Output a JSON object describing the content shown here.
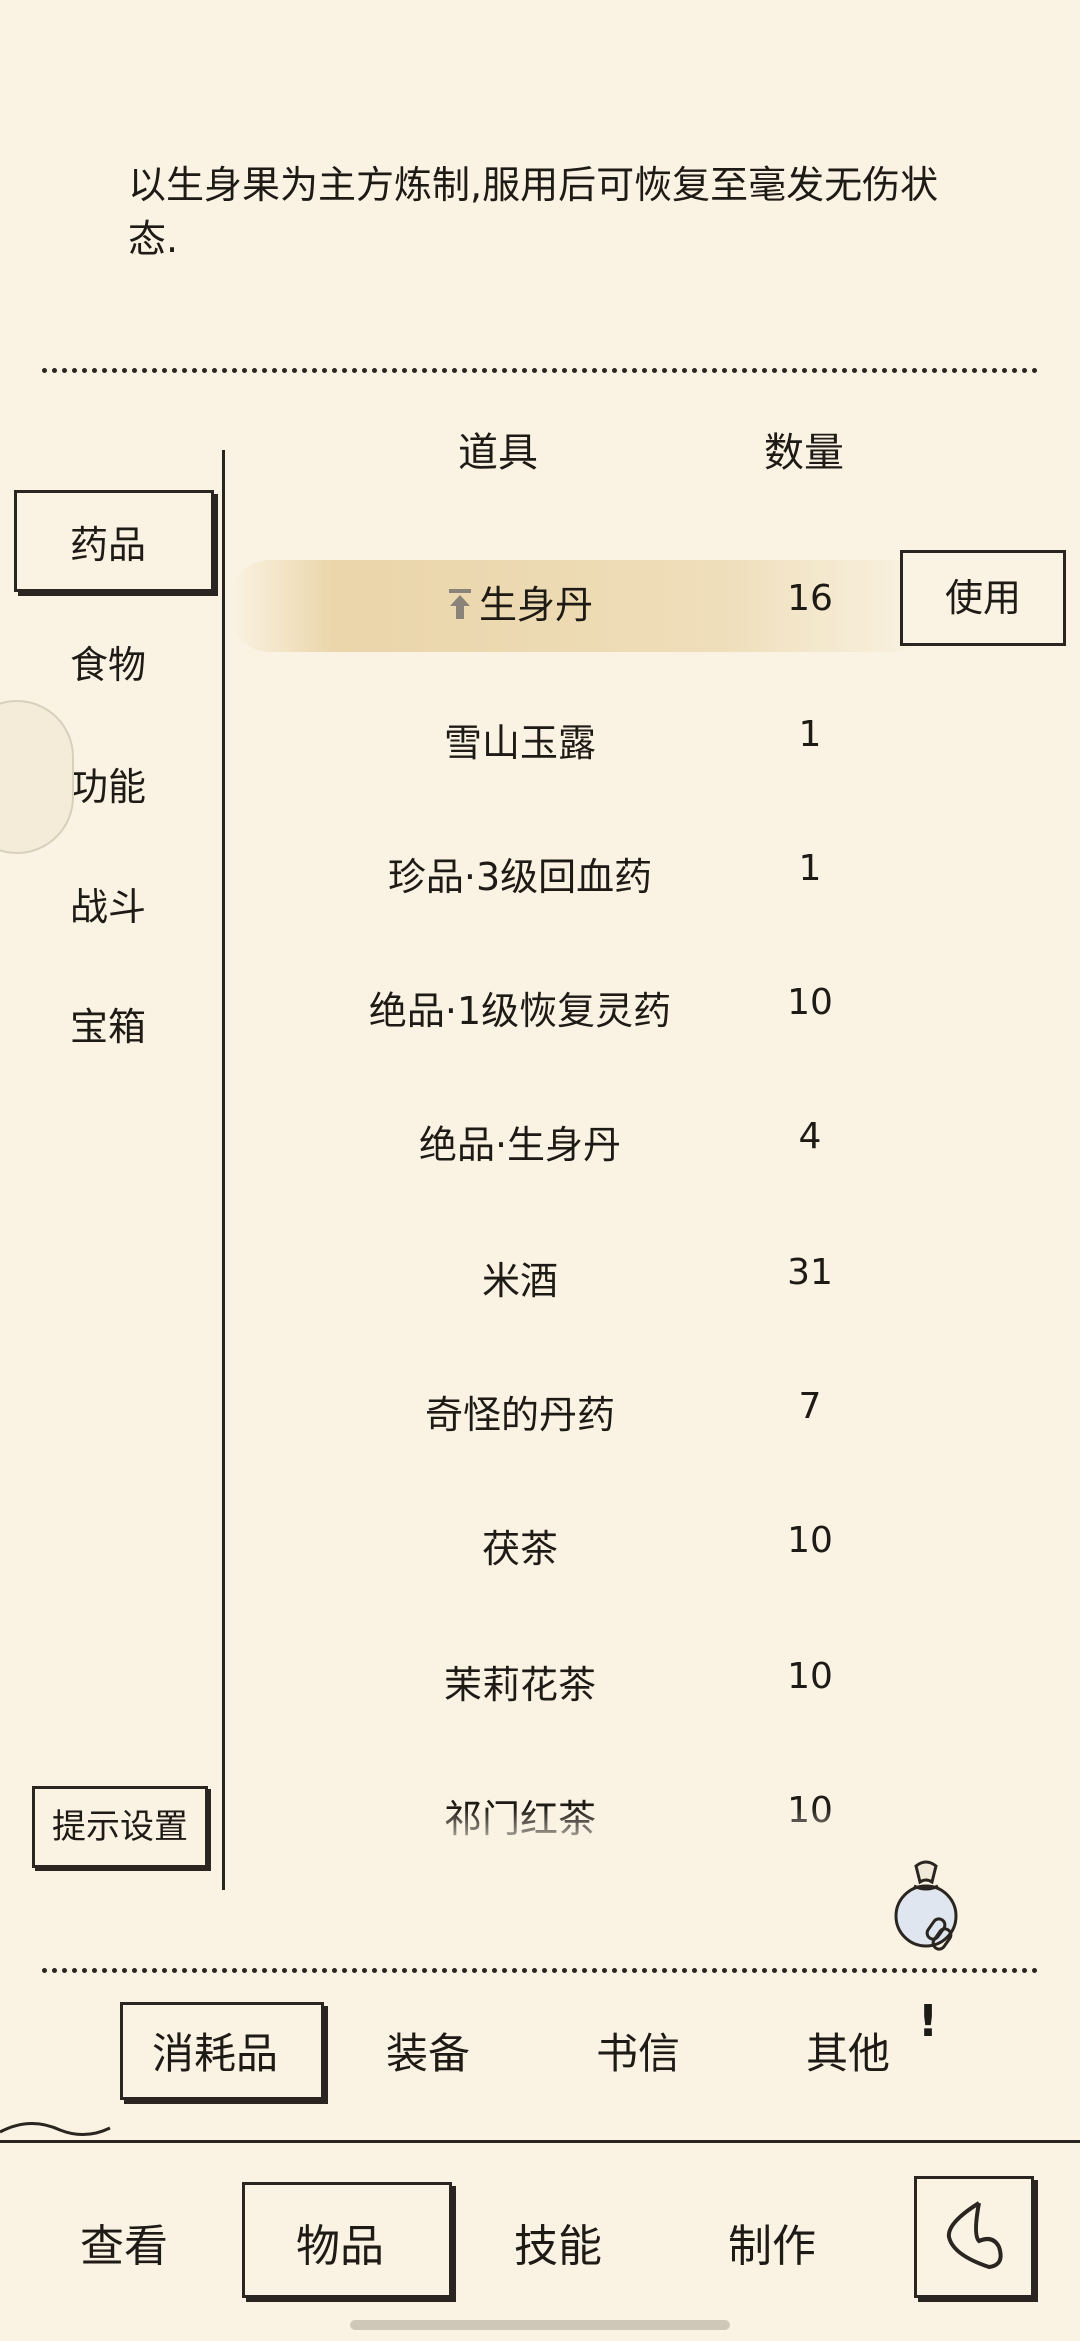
{
  "description": "以生身果为主方炼制,服用后可恢复至毫发无伤状态.",
  "table_headers": {
    "item": "道具",
    "count": "数量"
  },
  "categories": [
    {
      "label": "药品",
      "active": true
    },
    {
      "label": "食物",
      "active": false
    },
    {
      "label": "功能",
      "active": false
    },
    {
      "label": "战斗",
      "active": false
    },
    {
      "label": "宝箱",
      "active": false
    }
  ],
  "items": [
    {
      "name": "生身丹",
      "qty": "16",
      "selected": true
    },
    {
      "name": "雪山玉露",
      "qty": "1"
    },
    {
      "name": "珍品·3级回血药",
      "qty": "1"
    },
    {
      "name": "绝品·1级恢复灵药",
      "qty": "10"
    },
    {
      "name": "绝品·生身丹",
      "qty": "4"
    },
    {
      "name": "米酒",
      "qty": "31"
    },
    {
      "name": "奇怪的丹药",
      "qty": "7"
    },
    {
      "name": "茯茶",
      "qty": "10"
    },
    {
      "name": "茉莉花茶",
      "qty": "10"
    },
    {
      "name": "祁门红茶",
      "qty": "10"
    }
  ],
  "use_button": "使用",
  "hint_button": "提示设置",
  "item_tabs": [
    "消耗品",
    "装备",
    "书信",
    "其他"
  ],
  "active_item_tab": "消耗品",
  "nav": [
    "查看",
    "物品",
    "技能",
    "制作"
  ],
  "active_nav": "物品",
  "icons": [
    "pin-up-icon",
    "bag-icon",
    "back-icon",
    "alert-icon"
  ]
}
